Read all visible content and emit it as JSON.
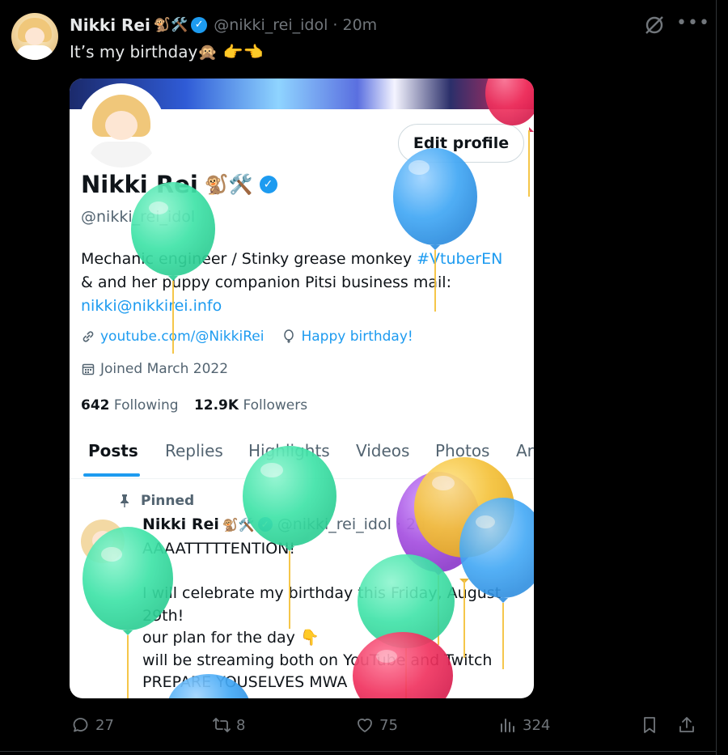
{
  "tweet": {
    "author_name": "Nikki Rei",
    "author_emoji": "🐒🛠️",
    "handle": "@nikki_rei_idol",
    "time": "· 20m",
    "text": "It’s my birthday🙊 👉👈"
  },
  "card": {
    "edit_profile": "Edit profile",
    "name": "Nikki Rei",
    "name_emoji": "🐒🛠️",
    "handle": "@nikki_rei_idol",
    "bio_line1": "Mechanic engineer / Stinky grease monkey ",
    "bio_hashtag": "#VtuberEN",
    "bio_line2": "& and her puppy companion Pitsi business mail:",
    "bio_email": "nikki@nikkirei.info",
    "website": "youtube.com/@NikkiRei",
    "birthday": "Happy birthday!",
    "joined": "Joined March 2022",
    "following_count": "642",
    "following_label": "Following",
    "followers_count": "12.9K",
    "followers_label": "Followers",
    "tabs": [
      "Posts",
      "Replies",
      "Highlights",
      "Videos",
      "Photos",
      "Ar"
    ],
    "pinned_label": "Pinned",
    "pinned_author": "Nikki Rei",
    "pinned_emoji": "🐒🛠️",
    "pinned_handle": "@nikki_rei_idol · 2d",
    "pinned_text": "AAAATTTTTENTION!\n\nI will celebrate my birthday this Friday, August 29th!\nour plan for the day 👇\nwill be streaming both on YouTube and Twitch\nPREPARE YOUSELVES MWA"
  },
  "actions": {
    "replies": "27",
    "reposts": "8",
    "likes": "75",
    "views": "324"
  },
  "colors": {
    "accent": "#1d9bf0",
    "muted": "#71767b",
    "balloon_green": "#3fe3a8",
    "balloon_blue": "#42a8f5",
    "balloon_pink": "#f0335f",
    "balloon_yellow": "#f5c23a",
    "balloon_purple": "#a54fe0"
  },
  "icons": [
    "grok-icon",
    "more-icon",
    "verified-icon",
    "link-icon",
    "balloon-icon",
    "calendar-icon",
    "pin-icon",
    "reply-icon",
    "repost-icon",
    "like-icon",
    "views-icon",
    "bookmark-icon",
    "share-icon"
  ]
}
